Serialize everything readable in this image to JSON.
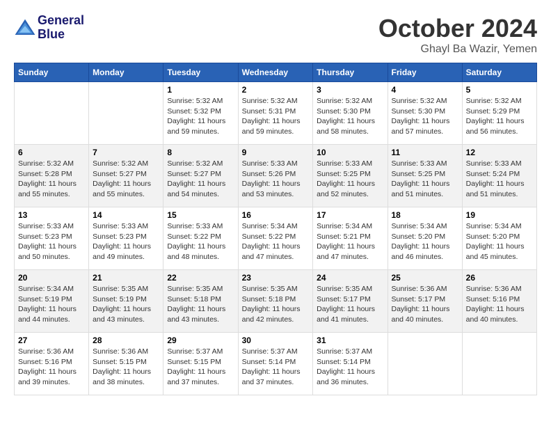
{
  "header": {
    "logo_line1": "General",
    "logo_line2": "Blue",
    "month": "October 2024",
    "location": "Ghayl Ba Wazir, Yemen"
  },
  "days_of_week": [
    "Sunday",
    "Monday",
    "Tuesday",
    "Wednesday",
    "Thursday",
    "Friday",
    "Saturday"
  ],
  "weeks": [
    [
      {
        "day": "",
        "info": ""
      },
      {
        "day": "",
        "info": ""
      },
      {
        "day": "1",
        "info": "Sunrise: 5:32 AM\nSunset: 5:32 PM\nDaylight: 11 hours\nand 59 minutes."
      },
      {
        "day": "2",
        "info": "Sunrise: 5:32 AM\nSunset: 5:31 PM\nDaylight: 11 hours\nand 59 minutes."
      },
      {
        "day": "3",
        "info": "Sunrise: 5:32 AM\nSunset: 5:30 PM\nDaylight: 11 hours\nand 58 minutes."
      },
      {
        "day": "4",
        "info": "Sunrise: 5:32 AM\nSunset: 5:30 PM\nDaylight: 11 hours\nand 57 minutes."
      },
      {
        "day": "5",
        "info": "Sunrise: 5:32 AM\nSunset: 5:29 PM\nDaylight: 11 hours\nand 56 minutes."
      }
    ],
    [
      {
        "day": "6",
        "info": "Sunrise: 5:32 AM\nSunset: 5:28 PM\nDaylight: 11 hours\nand 55 minutes."
      },
      {
        "day": "7",
        "info": "Sunrise: 5:32 AM\nSunset: 5:27 PM\nDaylight: 11 hours\nand 55 minutes."
      },
      {
        "day": "8",
        "info": "Sunrise: 5:32 AM\nSunset: 5:27 PM\nDaylight: 11 hours\nand 54 minutes."
      },
      {
        "day": "9",
        "info": "Sunrise: 5:33 AM\nSunset: 5:26 PM\nDaylight: 11 hours\nand 53 minutes."
      },
      {
        "day": "10",
        "info": "Sunrise: 5:33 AM\nSunset: 5:25 PM\nDaylight: 11 hours\nand 52 minutes."
      },
      {
        "day": "11",
        "info": "Sunrise: 5:33 AM\nSunset: 5:25 PM\nDaylight: 11 hours\nand 51 minutes."
      },
      {
        "day": "12",
        "info": "Sunrise: 5:33 AM\nSunset: 5:24 PM\nDaylight: 11 hours\nand 51 minutes."
      }
    ],
    [
      {
        "day": "13",
        "info": "Sunrise: 5:33 AM\nSunset: 5:23 PM\nDaylight: 11 hours\nand 50 minutes."
      },
      {
        "day": "14",
        "info": "Sunrise: 5:33 AM\nSunset: 5:23 PM\nDaylight: 11 hours\nand 49 minutes."
      },
      {
        "day": "15",
        "info": "Sunrise: 5:33 AM\nSunset: 5:22 PM\nDaylight: 11 hours\nand 48 minutes."
      },
      {
        "day": "16",
        "info": "Sunrise: 5:34 AM\nSunset: 5:22 PM\nDaylight: 11 hours\nand 47 minutes."
      },
      {
        "day": "17",
        "info": "Sunrise: 5:34 AM\nSunset: 5:21 PM\nDaylight: 11 hours\nand 47 minutes."
      },
      {
        "day": "18",
        "info": "Sunrise: 5:34 AM\nSunset: 5:20 PM\nDaylight: 11 hours\nand 46 minutes."
      },
      {
        "day": "19",
        "info": "Sunrise: 5:34 AM\nSunset: 5:20 PM\nDaylight: 11 hours\nand 45 minutes."
      }
    ],
    [
      {
        "day": "20",
        "info": "Sunrise: 5:34 AM\nSunset: 5:19 PM\nDaylight: 11 hours\nand 44 minutes."
      },
      {
        "day": "21",
        "info": "Sunrise: 5:35 AM\nSunset: 5:19 PM\nDaylight: 11 hours\nand 43 minutes."
      },
      {
        "day": "22",
        "info": "Sunrise: 5:35 AM\nSunset: 5:18 PM\nDaylight: 11 hours\nand 43 minutes."
      },
      {
        "day": "23",
        "info": "Sunrise: 5:35 AM\nSunset: 5:18 PM\nDaylight: 11 hours\nand 42 minutes."
      },
      {
        "day": "24",
        "info": "Sunrise: 5:35 AM\nSunset: 5:17 PM\nDaylight: 11 hours\nand 41 minutes."
      },
      {
        "day": "25",
        "info": "Sunrise: 5:36 AM\nSunset: 5:17 PM\nDaylight: 11 hours\nand 40 minutes."
      },
      {
        "day": "26",
        "info": "Sunrise: 5:36 AM\nSunset: 5:16 PM\nDaylight: 11 hours\nand 40 minutes."
      }
    ],
    [
      {
        "day": "27",
        "info": "Sunrise: 5:36 AM\nSunset: 5:16 PM\nDaylight: 11 hours\nand 39 minutes."
      },
      {
        "day": "28",
        "info": "Sunrise: 5:36 AM\nSunset: 5:15 PM\nDaylight: 11 hours\nand 38 minutes."
      },
      {
        "day": "29",
        "info": "Sunrise: 5:37 AM\nSunset: 5:15 PM\nDaylight: 11 hours\nand 37 minutes."
      },
      {
        "day": "30",
        "info": "Sunrise: 5:37 AM\nSunset: 5:14 PM\nDaylight: 11 hours\nand 37 minutes."
      },
      {
        "day": "31",
        "info": "Sunrise: 5:37 AM\nSunset: 5:14 PM\nDaylight: 11 hours\nand 36 minutes."
      },
      {
        "day": "",
        "info": ""
      },
      {
        "day": "",
        "info": ""
      }
    ]
  ]
}
